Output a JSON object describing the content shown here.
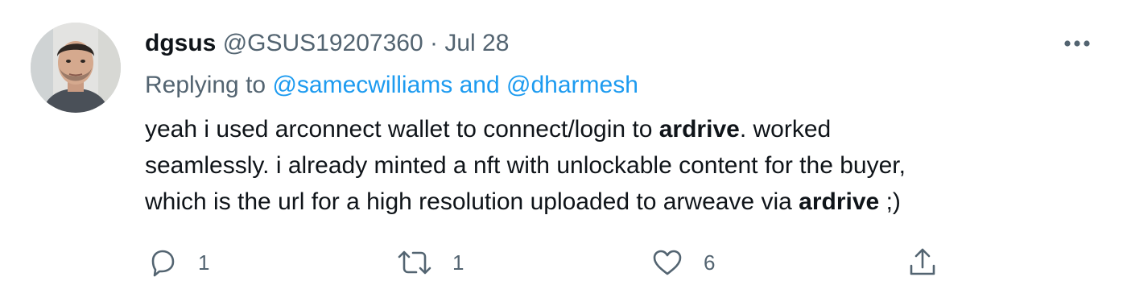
{
  "tweet": {
    "display_name": "dgsus",
    "handle": "@GSUS19207360",
    "separator": "·",
    "date": "Jul 28",
    "replying_prefix": "Replying to",
    "reply_user_1": "@samecwilliams",
    "reply_and": "and",
    "reply_user_2": "@dharmesh",
    "text": {
      "l1_a": "yeah i used arconnect wallet to connect/login to",
      "l1_bold": "ardrive",
      "l1_b": ". worked",
      "l2": "seamlessly. i already minted a nft with unlockable content for the buyer,",
      "l3_a": "which is the url for a high resolution uploaded to arweave via",
      "l3_bold": "ardrive",
      "l3_b": " ;)"
    }
  },
  "actions": {
    "reply_count": "1",
    "retweet_count": "1",
    "like_count": "6"
  },
  "icons": {
    "more": "more-horizontal-icon",
    "reply": "reply-bubble-icon",
    "retweet": "retweet-arrows-icon",
    "like": "heart-icon",
    "share": "share-upload-icon"
  },
  "colors": {
    "text": "#0f1419",
    "secondary": "#536471",
    "link": "#1d9bf0"
  }
}
